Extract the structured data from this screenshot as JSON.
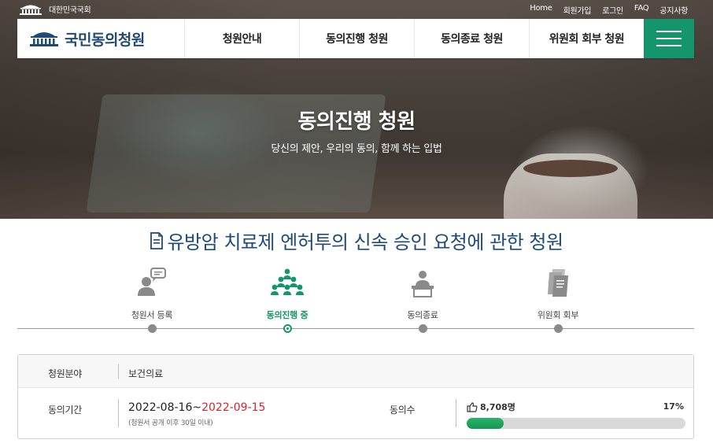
{
  "header": {
    "assembly_name": "대한민국국회",
    "util_links": [
      "Home",
      "회원가입",
      "로그인",
      "FAQ",
      "공지사항"
    ],
    "brand": "국민동의청원",
    "nav": [
      "청원안내",
      "동의진행 청원",
      "동의종료 청원",
      "위원회 회부 청원"
    ],
    "menu_icon": "hamburger-menu-icon"
  },
  "hero": {
    "title": "동의진행 청원",
    "subtitle": "당신의 제안, 우리의 동의, 함께 하는 입법"
  },
  "petition": {
    "title": "유방암 치료제 엔허투의 신속 승인 요청에 관한 청원",
    "title_icon": "document-icon"
  },
  "steps": [
    {
      "label": "청원서 등록",
      "icon": "speaking-person-icon",
      "active": false
    },
    {
      "label": "동의진행 중",
      "icon": "crowd-icon",
      "active": true
    },
    {
      "label": "동의종료",
      "icon": "podium-person-icon",
      "active": false
    },
    {
      "label": "위원회 회부",
      "icon": "document-stack-icon",
      "active": false
    }
  ],
  "info": {
    "field_label": "청원분야",
    "field_value": "보건의료",
    "period_label": "동의기간",
    "period_start": "2022-08-16~",
    "period_end": "2022-09-15",
    "period_note": "(청원서 공개 이후 30일 이내)",
    "agree_label": "동의수",
    "agree_count": "8,708명",
    "agree_percent_text": "17%",
    "agree_progress": 0.17
  },
  "colors": {
    "accent_green": "#14956b",
    "title_blue": "#1d4a7a",
    "end_date_red": "#d9232d"
  }
}
